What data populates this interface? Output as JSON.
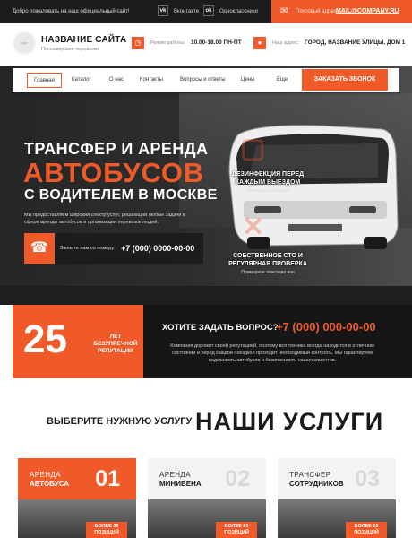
{
  "topbar": {
    "welcome": "Добро пожаловать на наш официальный сайт!",
    "social": [
      {
        "icon": "vk-icon",
        "glyph": "vk",
        "label": "Вконтакте"
      },
      {
        "icon": "ok-icon",
        "glyph": "ok",
        "label": "Одноклассники"
      }
    ],
    "mail_label": "Почтовый адрес:",
    "mail_value": "MAIL@COMPANY.RU",
    "mail_icon": "envelope-icon"
  },
  "header": {
    "logo_text": "logo",
    "site_name": "НАЗВАНИЕ САЙТА",
    "site_sub": "Пассажирские перевозки",
    "hours_label": "Режим работы:",
    "hours_value": "10.00-18.00 ПН-ПТ",
    "address_label": "Наш адрес:",
    "address_value": "ГОРОД, НАЗВАНИЕ УЛИЦЫ, ДОМ 1"
  },
  "nav": {
    "items": [
      "Главная",
      "Каталог",
      "О нас",
      "Контакты",
      "Вопросы и ответы",
      "Цены",
      "Еще"
    ],
    "cta": "ЗАКАЗАТЬ ЗВОНОК"
  },
  "hero": {
    "line1": "ТРАНСФЕР И АРЕНДА",
    "line2": "АВТОБУСОВ",
    "line3": "С ВОДИТЕЛЕМ В МОСКВЕ",
    "description": "Мы предоставляем широкий спектр услуг, решающий любые задачи в сфере аренды автобусов и организации перевозок людей.",
    "call_label": "Звоните нам по номеру:",
    "call_phone": "+7 (000) 0000-00-00",
    "features": [
      {
        "title": "ДЕЗИНФЕКЦИЯ ПЕРЕД КАЖДЫМ ВЫЕЗДОМ",
        "sub": "Примерное описание"
      },
      {
        "title": "СОБСТВЕННОЕ СТО И РЕГУЛЯРНАЯ ПРОВЕРКА",
        "sub": "Примерное описание ван"
      }
    ]
  },
  "stats": {
    "years": "25",
    "years_label": "ЛЕТ БЕЗУПРЕЧНОЙ РЕПУТАЦИИ",
    "question": "ХОТИТЕ ЗАДАТЬ ВОПРОС?",
    "phone": "+7 (000) 000-00-00",
    "text": "Компания дорожит своей репутацией, поэтому вся техника всегда находится в отличном состоянии и перед каждой поездкой проходит необходимый контроль. Мы гарантируем надежность автобусов и безопасность наших клиентов."
  },
  "services": {
    "subtitle": "ВЫБЕРИТЕ НУЖНУЮ УСЛУГУ",
    "title": "НАШИ УСЛУГИ",
    "cards": [
      {
        "l1": "АРЕНДА",
        "l2": "АВТОБУСА",
        "num": "01",
        "badge1": "БОЛЕЕ 30",
        "badge2": "ПОЗИЦИЙ"
      },
      {
        "l1": "АРЕНДА",
        "l2": "МИНИВЕНА",
        "num": "02",
        "badge1": "БОЛЕЕ 20",
        "badge2": "ПОЗИЦИЙ"
      },
      {
        "l1": "ТРАНСФЕР",
        "l2": "СОТРУДНИКОВ",
        "num": "03",
        "badge1": "БОЛЕЕ 20",
        "badge2": "ПОЗИЦИЙ"
      }
    ]
  },
  "colors": {
    "accent": "#f05a28",
    "dark": "#1c1c1c"
  }
}
